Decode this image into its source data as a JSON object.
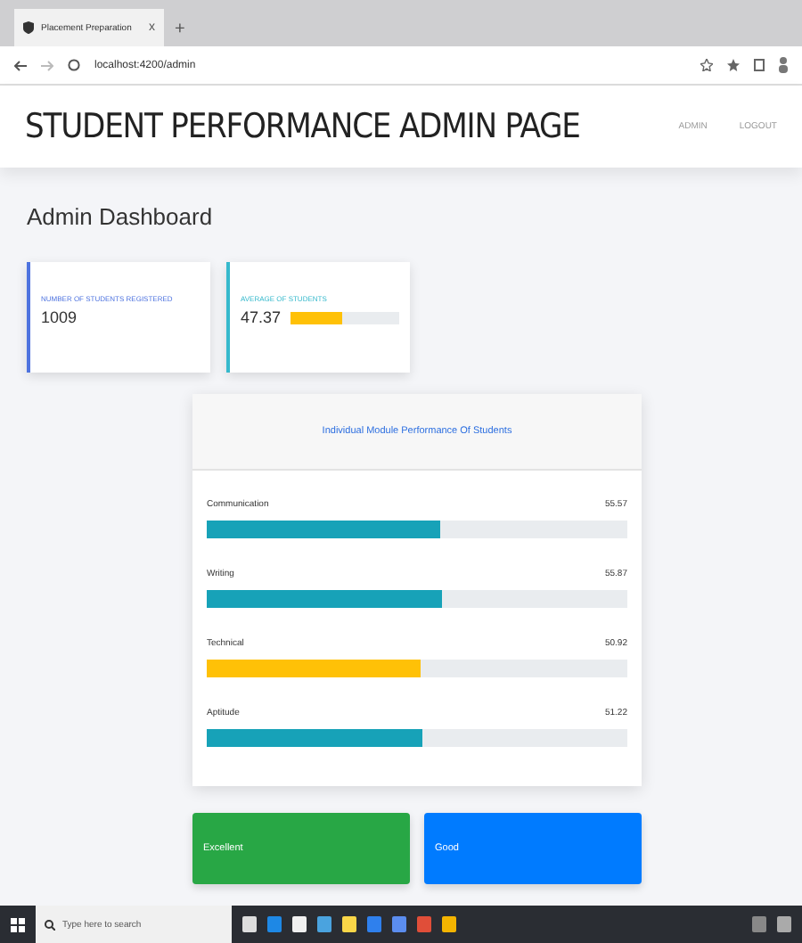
{
  "browser": {
    "tab_title": "Placement Preparation",
    "tab_close": "x",
    "new_tab": "+",
    "address": "localhost:4200/admin"
  },
  "header": {
    "title": "STUDENT PERFORMANCE ADMIN PAGE",
    "nav": [
      "ADMIN",
      "LOGOUT"
    ]
  },
  "page_title": "Admin Dashboard",
  "stats": [
    {
      "label": "NUMBER OF STUDENTS REGISTERED",
      "value": "1009",
      "color": "#4e73df"
    },
    {
      "label": "AVERAGE OF STUDENTS",
      "value": "47.37",
      "level": 0.4737,
      "color": "#36b9cc"
    }
  ],
  "modules": {
    "title": "Individual Module Performance Of Students",
    "items": [
      {
        "name": "Communication",
        "reading": "55.57",
        "level": 0.5557,
        "color": "#17a2b8"
      },
      {
        "name": "Writing",
        "reading": "55.87",
        "level": 0.5587,
        "color": "#17a2b8"
      },
      {
        "name": "Technical",
        "reading": "50.92",
        "level": 0.5092,
        "color": "#ffc107"
      },
      {
        "name": "Aptitude",
        "reading": "51.22",
        "level": 0.5122,
        "color": "#17a2b8"
      }
    ]
  },
  "grades": [
    {
      "label": "Excellent",
      "color": "#28a745"
    },
    {
      "label": "Good",
      "color": "#007bff"
    }
  ],
  "taskbar": {
    "search_placeholder": "Type here to search"
  }
}
